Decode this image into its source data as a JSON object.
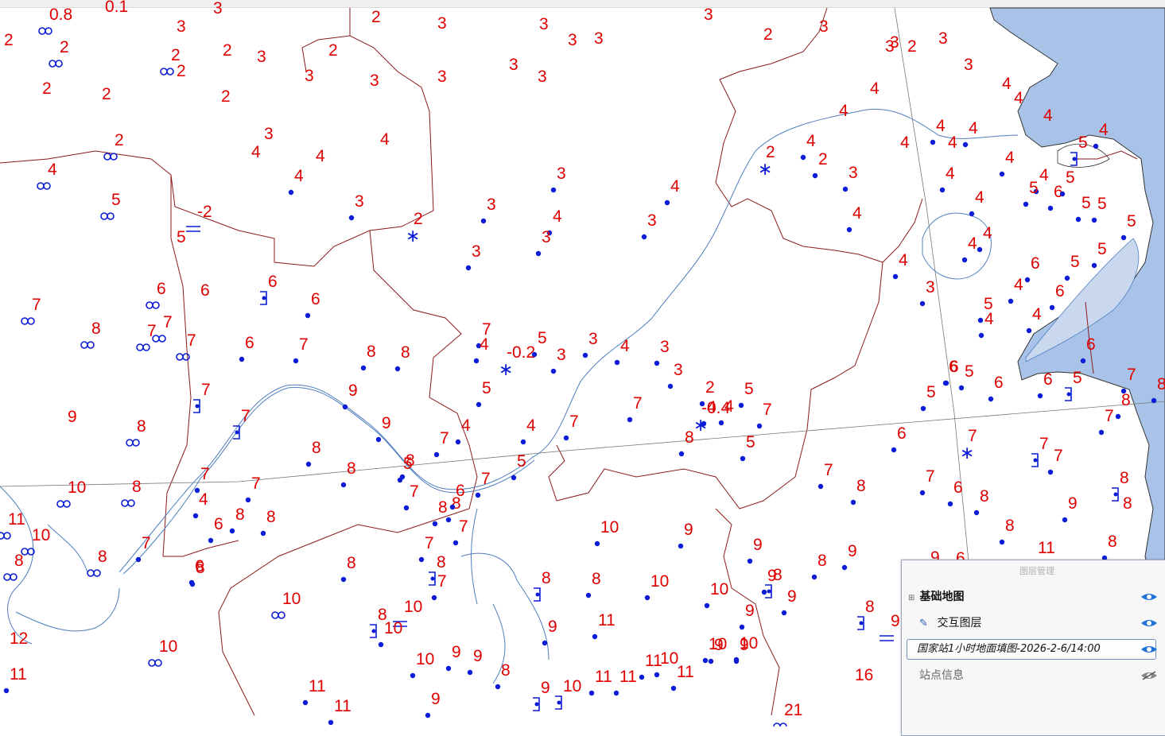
{
  "layer_panel": {
    "title": "图层管理",
    "layers": [
      {
        "label": "基础地图"
      },
      {
        "label": "交互图层"
      },
      {
        "label": "国家站1小时地面填图-2026-2-6/14:00"
      },
      {
        "label": "站点信息"
      }
    ]
  },
  "colors": {
    "value_text": "#e00000",
    "station_symbol": "#0b1cd6",
    "river": "#4f7fbf",
    "boundary": "#8b1a1a",
    "sea": "#a9c3e8"
  },
  "stations": [
    [
      "0.8",
      "inf"
    ],
    [
      "0.1",
      "none"
    ],
    [
      "3",
      "none"
    ],
    [
      "2",
      "none"
    ],
    [
      "3",
      "none"
    ],
    [
      "3",
      "none"
    ],
    [
      "2",
      "none"
    ],
    [
      "3",
      "none"
    ],
    [
      "3",
      "none"
    ],
    [
      "2",
      "inf"
    ],
    [
      "2",
      "inf"
    ],
    [
      "2",
      "none"
    ],
    [
      "2",
      "none"
    ],
    [
      "3",
      "none"
    ],
    [
      "3",
      "none"
    ],
    [
      "3",
      "none"
    ],
    [
      "2",
      "none"
    ],
    [
      "2",
      "none"
    ],
    [
      "2",
      "none"
    ],
    [
      "2",
      "none"
    ],
    [
      "3",
      "none"
    ],
    [
      "3",
      "none"
    ],
    [
      "3",
      "none"
    ],
    [
      "3",
      "none"
    ],
    [
      "3",
      "none"
    ],
    [
      "2",
      "none"
    ],
    [
      "3",
      "none"
    ],
    [
      "3",
      "none"
    ],
    [
      "2",
      "inf"
    ],
    [
      "4",
      "inf"
    ],
    [
      "4",
      "none"
    ],
    [
      "4",
      "none"
    ],
    [
      "4",
      "none"
    ],
    [
      "4",
      "dot"
    ],
    [
      "3",
      "none"
    ],
    [
      "4",
      "none"
    ],
    [
      "3",
      "dot"
    ],
    [
      "2",
      "star"
    ],
    [
      "3",
      "dot"
    ],
    [
      "3",
      "dot"
    ],
    [
      "4",
      "dot"
    ],
    [
      "3",
      "dot"
    ],
    [
      "3",
      "dot"
    ],
    [
      "4",
      "dot"
    ],
    [
      "3",
      "dot"
    ],
    [
      "2",
      "dot"
    ],
    [
      "4",
      "dot"
    ],
    [
      "2",
      "star"
    ],
    [
      "3",
      "dot"
    ],
    [
      "4",
      "dot"
    ],
    [
      "4",
      "dot"
    ],
    [
      "4",
      "dot"
    ],
    [
      "-2",
      "rain"
    ],
    [
      "5",
      "none"
    ],
    [
      "5",
      "inf"
    ],
    [
      "6",
      "inf"
    ],
    [
      "6",
      "none"
    ],
    [
      "6",
      "box"
    ],
    [
      "6",
      "dot"
    ],
    [
      "7",
      "inf"
    ],
    [
      "8",
      "inf"
    ],
    [
      "7",
      "inf"
    ],
    [
      "7",
      "inf"
    ],
    [
      "7",
      "inf"
    ],
    [
      "6",
      "dot"
    ],
    [
      "7",
      "dot"
    ],
    [
      "8",
      "dot"
    ],
    [
      "8",
      "dot"
    ],
    [
      "7",
      "dot"
    ],
    [
      "4",
      "dot"
    ],
    [
      "-0.2",
      "star"
    ],
    [
      "5",
      "dot"
    ],
    [
      "3",
      "dot"
    ],
    [
      "3",
      "dot"
    ],
    [
      "4",
      "dot"
    ],
    [
      "3",
      "dot"
    ],
    [
      "3",
      "dot"
    ],
    [
      "2",
      "dot"
    ],
    [
      "4",
      "dot"
    ],
    [
      "5",
      "dot"
    ],
    [
      "4",
      "dot"
    ],
    [
      "9",
      "none"
    ],
    [
      "8",
      "inf"
    ],
    [
      "7",
      "box"
    ],
    [
      "9",
      "dot"
    ],
    [
      "5",
      "dot"
    ],
    [
      "7",
      "dot"
    ],
    [
      "7",
      "box"
    ],
    [
      "8",
      "dot"
    ],
    [
      "9",
      "dot"
    ],
    [
      "7",
      "dot"
    ],
    [
      "4",
      "dot"
    ],
    [
      "4",
      "dot"
    ],
    [
      "7",
      "dot"
    ],
    [
      "5",
      "dot"
    ],
    [
      "-0.4",
      "star"
    ],
    [
      "7",
      "dot"
    ],
    [
      "8",
      "dot"
    ],
    [
      "5",
      "dot"
    ],
    [
      "10",
      "inf"
    ],
    [
      "8",
      "inf"
    ],
    [
      "7",
      "dot"
    ],
    [
      "7",
      "dot"
    ],
    [
      "8",
      "dot"
    ],
    [
      "8",
      "dot"
    ],
    [
      "5",
      "dot"
    ],
    [
      "7",
      "dot"
    ],
    [
      "8",
      "dot"
    ],
    [
      "8",
      "dot"
    ],
    [
      "8",
      "dot"
    ],
    [
      "7",
      "dot"
    ],
    [
      "8",
      "dot"
    ],
    [
      "4",
      "dot"
    ],
    [
      "6",
      "dot"
    ],
    [
      "7",
      "dot"
    ],
    [
      "6",
      "dot"
    ],
    [
      "6",
      "dot"
    ],
    [
      "11",
      "inf"
    ],
    [
      "10",
      "inf"
    ],
    [
      "8",
      "inf"
    ],
    [
      "8",
      "inf"
    ],
    [
      "7",
      "dot"
    ],
    [
      "8",
      "dot"
    ],
    [
      "8",
      "dot"
    ],
    [
      "7",
      "dot"
    ],
    [
      "8",
      "box"
    ],
    [
      "7",
      "dot"
    ],
    [
      "8",
      "box"
    ],
    [
      "10",
      "dot"
    ],
    [
      "9",
      "dot"
    ],
    [
      "9",
      "dot"
    ],
    [
      "8",
      "dot"
    ],
    [
      "9",
      "dot"
    ],
    [
      "8",
      "box"
    ],
    [
      "8",
      "box"
    ],
    [
      "10",
      "inf"
    ],
    [
      "8",
      "box"
    ],
    [
      "10",
      "rain"
    ],
    [
      "10",
      "dot"
    ],
    [
      "9",
      "dot"
    ],
    [
      "10",
      "dot"
    ],
    [
      "8",
      "dot"
    ],
    [
      "11",
      "dot"
    ],
    [
      "10",
      "dot"
    ],
    [
      "9",
      "dot"
    ],
    [
      "9",
      "dot"
    ],
    [
      "9",
      "dot"
    ],
    [
      "9",
      "rain"
    ],
    [
      "12",
      "none"
    ],
    [
      "10",
      "inf"
    ],
    [
      "10",
      "dot"
    ],
    [
      "10",
      "dot"
    ],
    [
      "9",
      "dot"
    ],
    [
      "9",
      "dot"
    ],
    [
      "8",
      "dot"
    ],
    [
      "9",
      "box"
    ],
    [
      "10",
      "box"
    ],
    [
      "11",
      "dot"
    ],
    [
      "11",
      "dot"
    ],
    [
      "11",
      "dot"
    ],
    [
      "10",
      "dot"
    ],
    [
      "11",
      "dot"
    ],
    [
      "9",
      "dot"
    ],
    [
      "10",
      "dot"
    ],
    [
      "9",
      "dot"
    ],
    [
      "11",
      "dot"
    ],
    [
      "11",
      "dot"
    ],
    [
      "9",
      "dot"
    ],
    [
      "16",
      "none"
    ],
    [
      "21",
      "inf"
    ],
    [
      "11",
      "dot"
    ],
    [
      "5",
      "dot"
    ],
    [
      "4",
      "dot"
    ],
    [
      "4",
      "dot"
    ],
    [
      "4",
      "dot"
    ],
    [
      "5",
      "dot"
    ],
    [
      "6",
      "dot"
    ],
    [
      "6",
      "dot"
    ],
    [
      "5",
      "dot"
    ],
    [
      "6",
      "dot"
    ],
    [
      "7",
      "star"
    ],
    [
      "7",
      "box"
    ],
    [
      "7",
      "dot"
    ],
    [
      "8",
      "dot"
    ],
    [
      "7",
      "dot"
    ],
    [
      "6",
      "dot"
    ],
    [
      "8",
      "dot"
    ],
    [
      "9",
      "dot"
    ],
    [
      "8",
      "dot"
    ],
    [
      "11",
      "none"
    ],
    [
      "8",
      "box"
    ],
    [
      "8",
      "none"
    ],
    [
      "9",
      "none"
    ],
    [
      "8",
      "dot"
    ],
    [
      "6",
      "dot"
    ],
    [
      "7",
      "dot"
    ],
    [
      "7",
      "dot"
    ],
    [
      "8",
      "dot"
    ],
    [
      "3",
      "none"
    ],
    [
      "3",
      "none"
    ],
    [
      "2",
      "none"
    ],
    [
      "3",
      "none"
    ],
    [
      "4",
      "none"
    ],
    [
      "4",
      "none"
    ],
    [
      "4",
      "none"
    ],
    [
      "4",
      "dot"
    ],
    [
      "4",
      "none"
    ],
    [
      "4",
      "none"
    ],
    [
      "5",
      "box"
    ],
    [
      "4",
      "none"
    ],
    [
      "4",
      "dot"
    ],
    [
      "4",
      "dot"
    ],
    [
      "4",
      "dot"
    ],
    [
      "4",
      "dot"
    ],
    [
      "5",
      "dot"
    ],
    [
      "6",
      "dot"
    ],
    [
      "5",
      "dot"
    ],
    [
      "5",
      "dot"
    ],
    [
      "5",
      "dot"
    ],
    [
      "5",
      "dot"
    ],
    [
      "5",
      "dot"
    ],
    [
      "4",
      "dot"
    ],
    [
      "3",
      "dot"
    ],
    [
      "4",
      "dot"
    ],
    [
      "4",
      "dot"
    ],
    [
      "5",
      "dot"
    ],
    [
      "6",
      "dot"
    ],
    [
      "6",
      "dot"
    ],
    [
      "6",
      "dot"
    ],
    [
      "5",
      "box"
    ],
    [
      "6",
      "dot"
    ],
    [
      "7",
      "dot"
    ],
    [
      "8",
      "dot"
    ],
    [
      "6",
      "dot"
    ]
  ]
}
